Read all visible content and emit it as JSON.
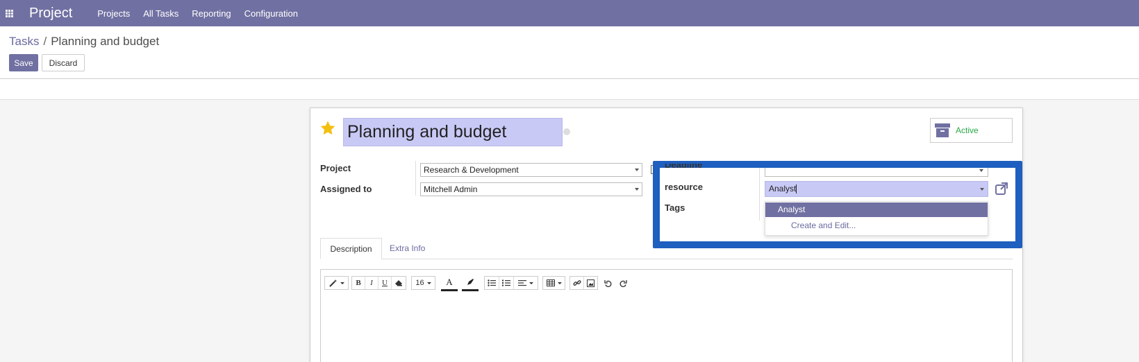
{
  "navbar": {
    "app_title": "Project",
    "menu": [
      "Projects",
      "All Tasks",
      "Reporting",
      "Configuration"
    ],
    "bg_color": "#7170a2"
  },
  "breadcrumb": {
    "parent": "Tasks",
    "separator": "/",
    "current": "Planning and budget"
  },
  "buttons": {
    "save": "Save",
    "discard": "Discard"
  },
  "task": {
    "title": "Planning and budget",
    "starred": true,
    "status_button": "Active"
  },
  "fields": {
    "project_label": "Project",
    "project_value": "Research & Development",
    "assigned_label": "Assigned to",
    "assigned_value": "Mitchell Admin",
    "deadline_label": "Deadline",
    "resource_label": "resource",
    "resource_value": "Analyst",
    "tags_label": "Tags"
  },
  "dropdown": {
    "options": [
      "Analyst"
    ],
    "create_label": "Create and Edit..."
  },
  "notebook": {
    "tabs": [
      "Description",
      "Extra Info"
    ],
    "active_tab": "Description"
  },
  "editor_toolbar": {
    "font_size": "16",
    "icons": [
      "magic-style-icon",
      "bold-icon",
      "italic-icon",
      "underline-icon",
      "eraser-icon",
      "font-size-dropdown",
      "font-color-icon",
      "highlight-color-icon",
      "unordered-list-icon",
      "ordered-list-icon",
      "align-icon",
      "table-icon",
      "link-icon",
      "image-icon",
      "undo-icon",
      "redo-icon"
    ]
  },
  "colors": {
    "accent": "#7170a2",
    "highlight_border": "#1e5fbf",
    "active_green": "#28a745",
    "selected_input": "#c9c9f6"
  }
}
